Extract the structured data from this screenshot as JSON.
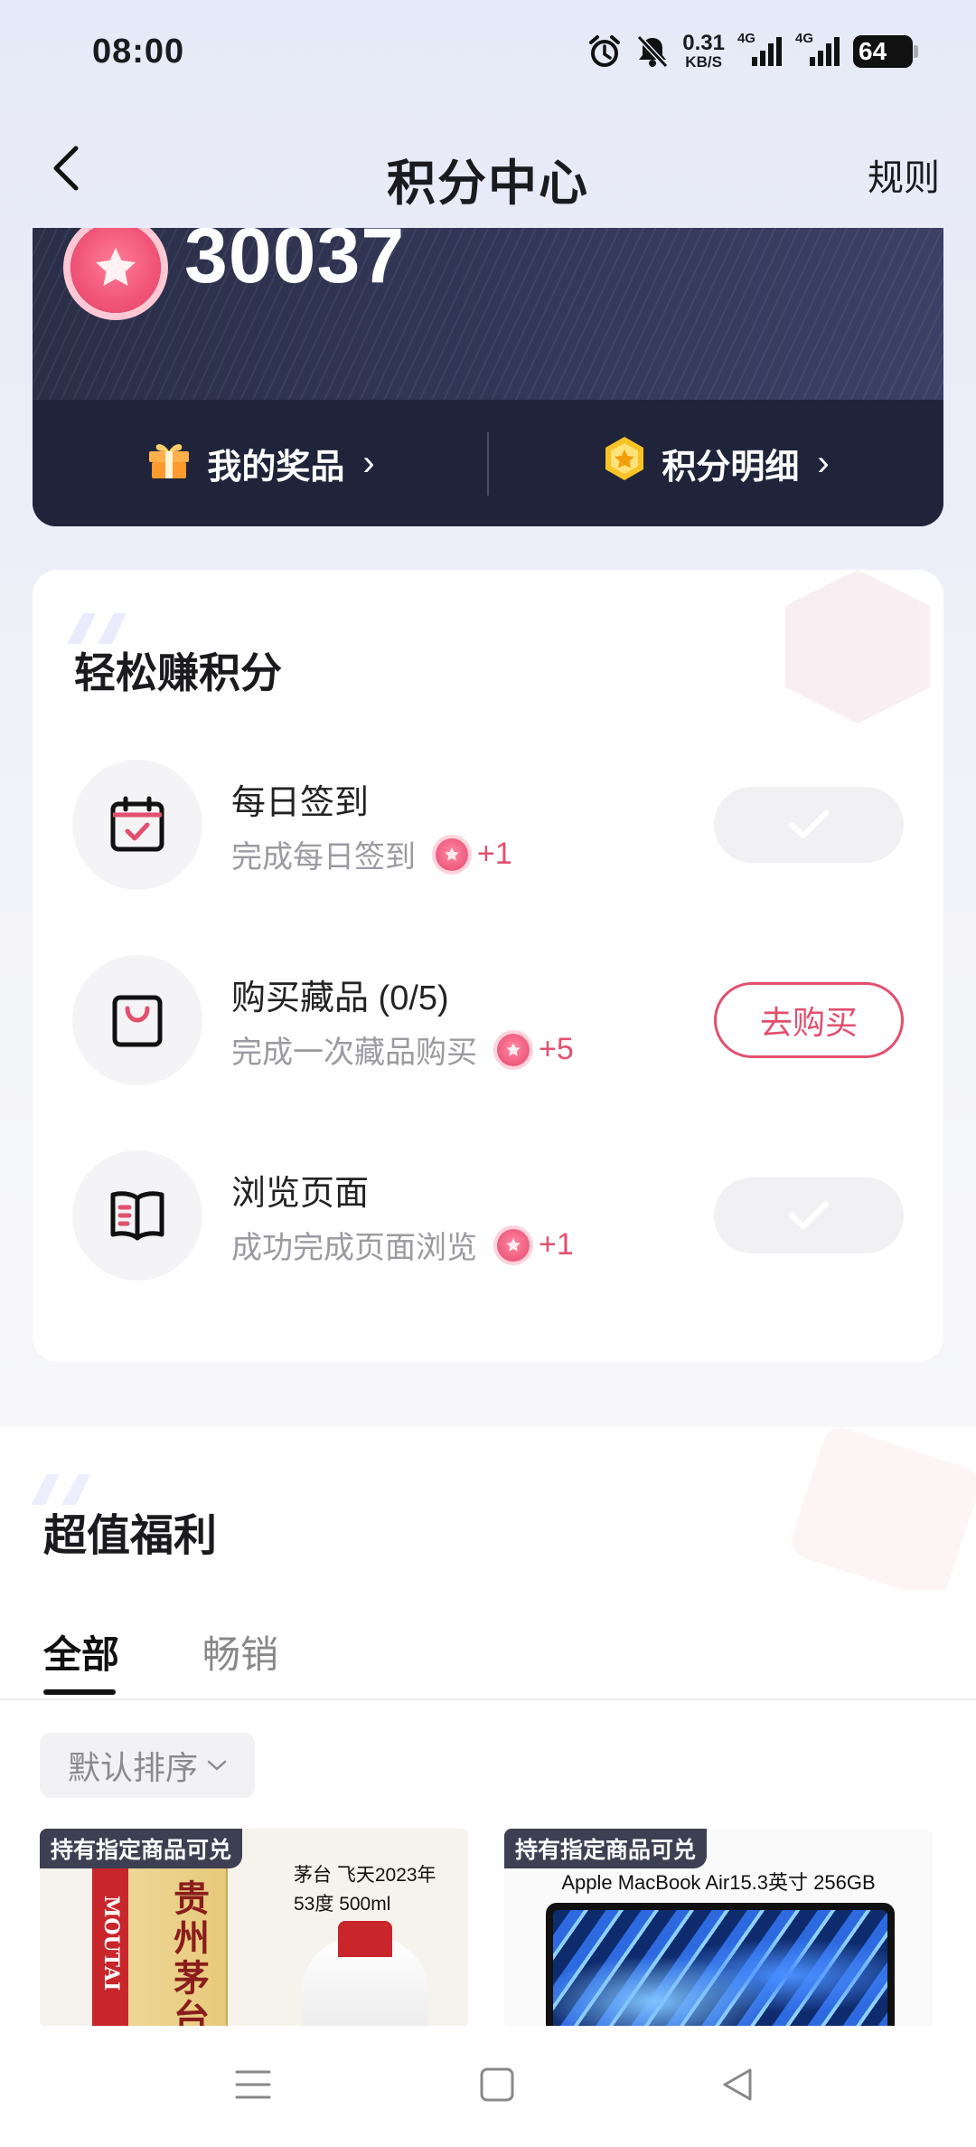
{
  "status_bar": {
    "time": "08:00",
    "speed_value": "0.31",
    "speed_unit": "KB/S",
    "network_1": "4G",
    "network_2": "4G",
    "battery": "64",
    "icons": [
      "alarm-icon",
      "mute-icon",
      "signal-icon",
      "signal-icon",
      "battery-icon"
    ]
  },
  "header": {
    "title": "积分中心",
    "rules_label": "规则",
    "back_icon": "back-arrow-icon"
  },
  "points": {
    "value": "30037",
    "my_prizes_label": "我的奖品",
    "points_detail_label": "积分明细",
    "chevron": "›"
  },
  "earn": {
    "title": "轻松赚积分",
    "tasks": [
      {
        "name": "每日签到",
        "desc": "完成每日签到",
        "reward": "+1",
        "state": "done",
        "icon": "calendar-check-icon"
      },
      {
        "name": "购买藏品 (0/5)",
        "desc": "完成一次藏品购买",
        "reward": "+5",
        "state": "todo",
        "button": "去购买",
        "icon": "shopping-bag-icon"
      },
      {
        "name": "浏览页面",
        "desc": "成功完成页面浏览",
        "reward": "+1",
        "state": "done",
        "icon": "open-book-icon"
      }
    ]
  },
  "benefits": {
    "title": "超值福利",
    "tabs": [
      "全部",
      "畅销"
    ],
    "active_tab": "全部",
    "sort_label": "默认排序",
    "products": [
      {
        "badge": "持有指定商品可兑",
        "name": "茅台 飞天2023年 53度 500ml",
        "box_text": "贵州茅台",
        "brand_text": "MOUTAI"
      },
      {
        "badge": "持有指定商品可兑",
        "name": "Apple MacBook Air15.3英寸 256GB"
      }
    ]
  },
  "colors": {
    "accent": "#e2506e",
    "card_dark": "#20243a",
    "background": "#f7f7f9"
  }
}
